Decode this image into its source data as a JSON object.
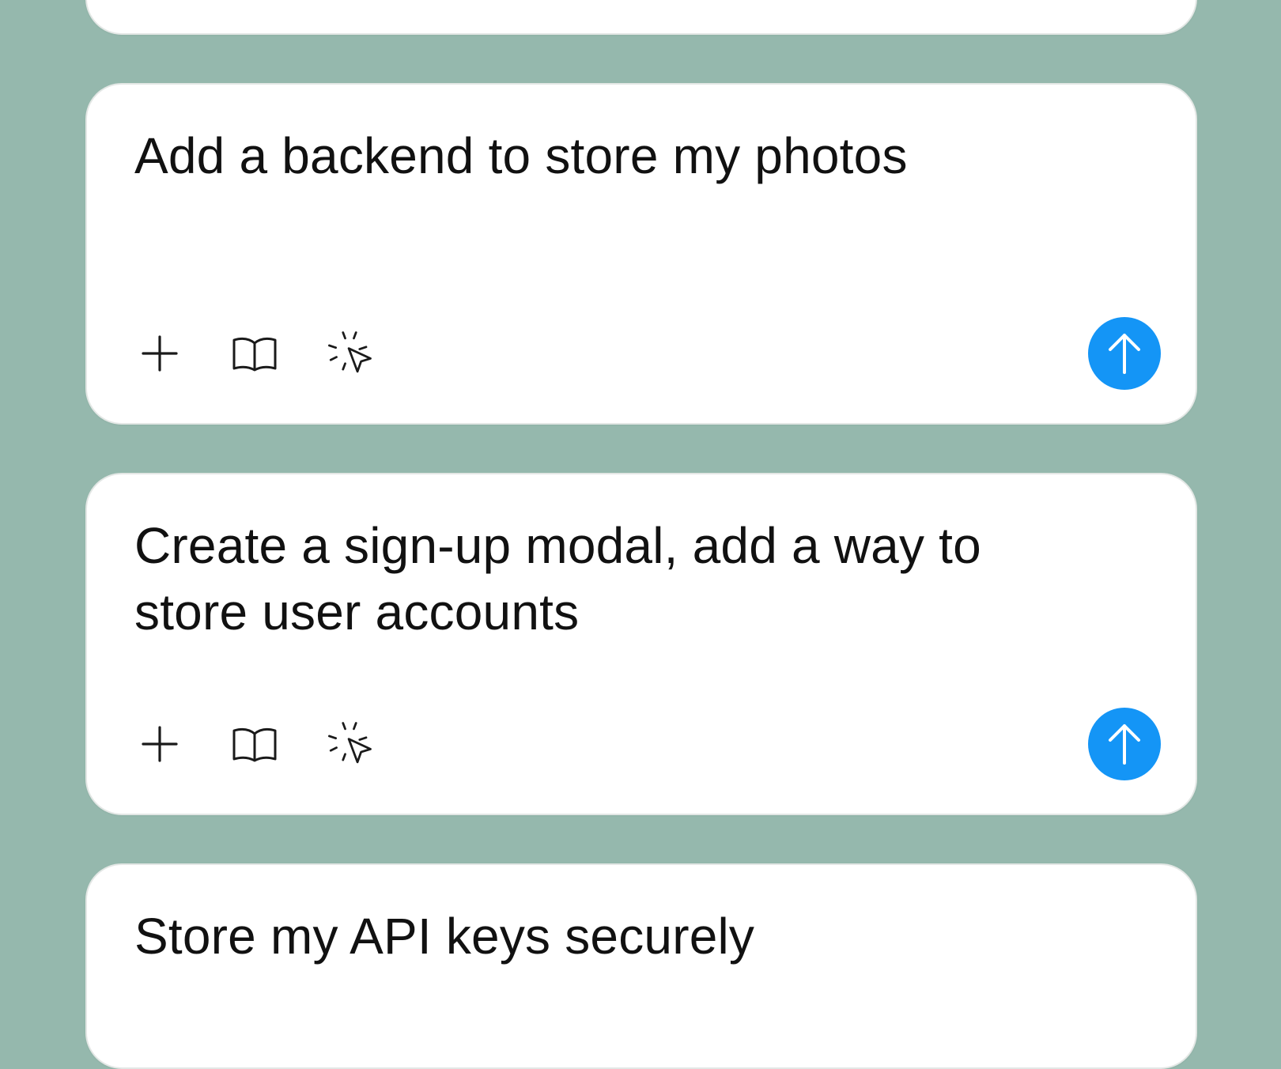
{
  "colors": {
    "background": "#95b8ad",
    "card": "#ffffff",
    "send_button": "#1495f6",
    "text": "#111111"
  },
  "cards": [
    {
      "prompt": ""
    },
    {
      "prompt": "Add a backend to store my photos",
      "tools": [
        "plus-icon",
        "book-icon",
        "cursor-click-icon"
      ],
      "send_icon": "arrow-up-icon"
    },
    {
      "prompt": "Create a sign-up modal, add a way to store user accounts",
      "tools": [
        "plus-icon",
        "book-icon",
        "cursor-click-icon"
      ],
      "send_icon": "arrow-up-icon"
    },
    {
      "prompt": "Store my API keys securely"
    }
  ]
}
